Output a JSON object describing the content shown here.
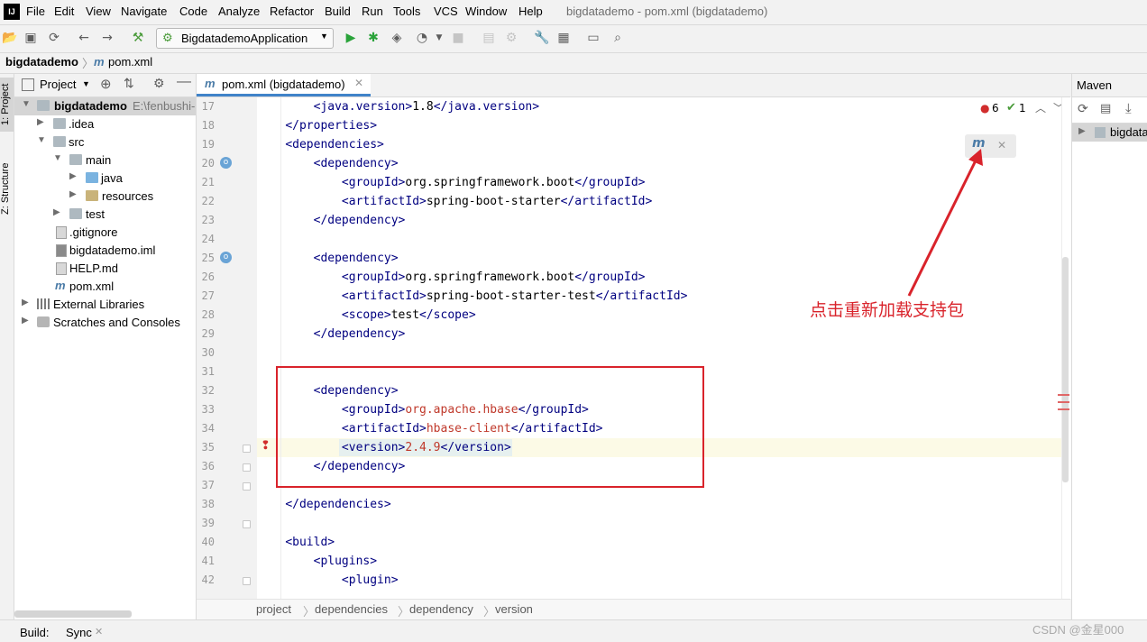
{
  "app": {
    "logo_text": "IJ",
    "window_title": "bigdatademo - pom.xml (bigdatademo)"
  },
  "menu": [
    "File",
    "Edit",
    "View",
    "Navigate",
    "Code",
    "Analyze",
    "Refactor",
    "Build",
    "Run",
    "Tools",
    "VCS",
    "Window",
    "Help"
  ],
  "toolbar": {
    "run_config": "BigdatademoApplication"
  },
  "navbar": {
    "project": "bigdatademo",
    "file": "pom.xml"
  },
  "side_tabs": {
    "project": "1: Project",
    "structure": "Z: Structure"
  },
  "project_panel": {
    "title": "Project",
    "tree": [
      {
        "label": "bigdatademo",
        "path": "E:\\fenbushi-",
        "bold": true
      },
      {
        "label": ".idea"
      },
      {
        "label": "src"
      },
      {
        "label": "main"
      },
      {
        "label": "java"
      },
      {
        "label": "resources"
      },
      {
        "label": "test"
      },
      {
        "label": ".gitignore"
      },
      {
        "label": "bigdatademo.iml"
      },
      {
        "label": "HELP.md"
      },
      {
        "label": "pom.xml"
      },
      {
        "label": "External Libraries"
      },
      {
        "label": "Scratches and Consoles"
      }
    ]
  },
  "editor": {
    "tab_label": "pom.xml (bigdatademo)",
    "errors": "6",
    "warnings": "1",
    "line_numbers": [
      "17",
      "18",
      "19",
      "20",
      "21",
      "22",
      "23",
      "24",
      "25",
      "26",
      "27",
      "28",
      "29",
      "30",
      "31",
      "32",
      "33",
      "34",
      "35",
      "36",
      "37",
      "38",
      "39",
      "40",
      "41",
      "42"
    ],
    "code_lines": [
      "        <java.version>1.8</java.version>",
      "    </properties>",
      "    <dependencies>",
      "        <dependency>",
      "            <groupId>org.springframework.boot</groupId>",
      "            <artifactId>spring-boot-starter</artifactId>",
      "        </dependency>",
      "",
      "        <dependency>",
      "            <groupId>org.springframework.boot</groupId>",
      "            <artifactId>spring-boot-starter-test</artifactId>",
      "            <scope>test</scope>",
      "        </dependency>",
      "",
      "",
      "        <dependency>",
      "            <groupId>org.apache.hbase</groupId>",
      "            <artifactId>hbase-client</artifactId>",
      "            <version>2.4.9</version>",
      "        </dependency>",
      "",
      "    </dependencies>",
      "",
      "    <build>",
      "        <plugins>",
      "            <plugin>"
    ],
    "breadcrumbs": [
      "project",
      "dependencies",
      "dependency",
      "version"
    ]
  },
  "annotation": {
    "text": "点击重新加载支持包"
  },
  "maven": {
    "title": "Maven",
    "root_item": "bigdata"
  },
  "statusbar": {
    "build_label": "Build:",
    "sync_label": "Sync",
    "watermark": "CSDN @金星000"
  },
  "colors": {
    "accent": "#4083c9",
    "annotation_red": "#d9232b",
    "tag_blue": "#000080",
    "value_red": "#c0392b"
  }
}
